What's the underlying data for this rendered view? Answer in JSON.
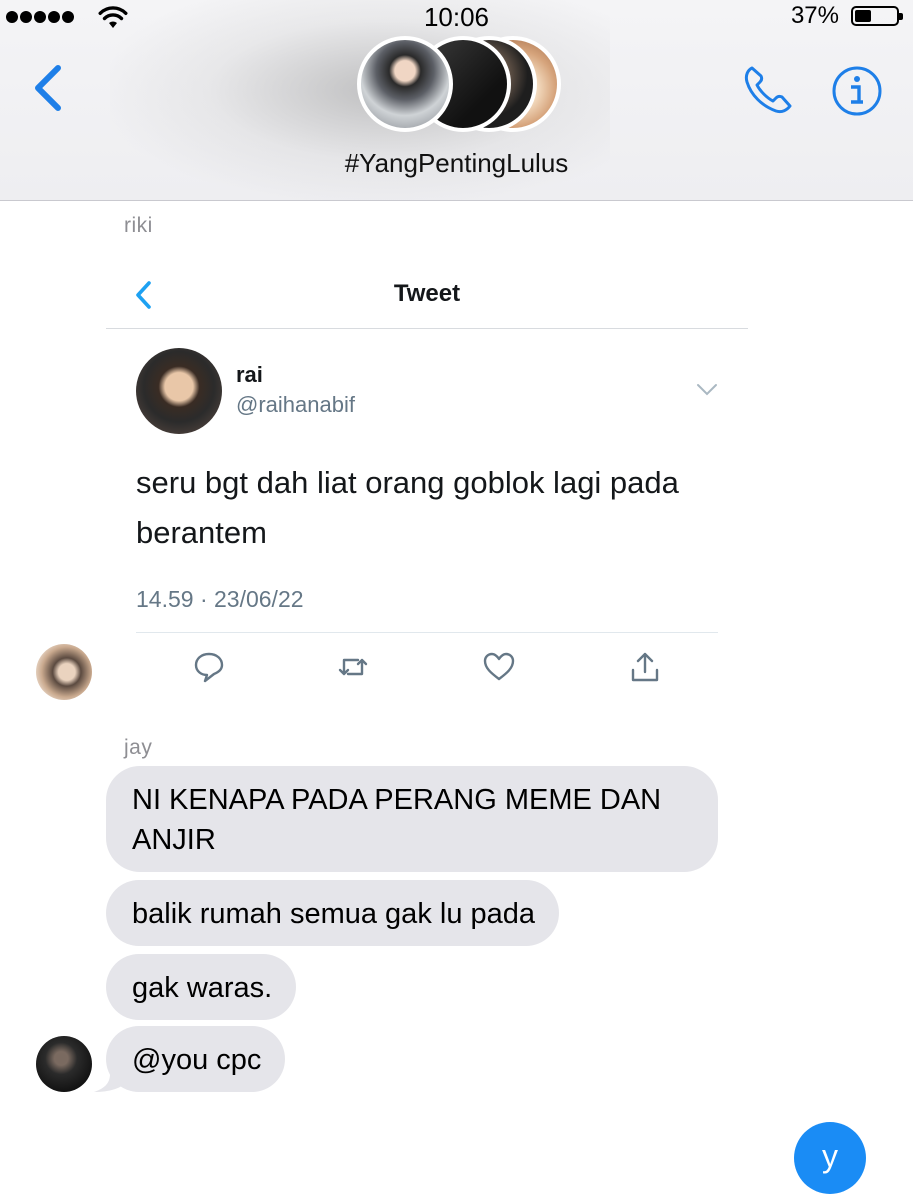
{
  "status": {
    "time": "10:06",
    "battery": "37%"
  },
  "nav": {
    "group_name": "#YangPentingLulus",
    "back_icon": "chevron-left-icon",
    "call_icon": "phone-icon",
    "info_icon": "info-icon"
  },
  "chat": {
    "shared_tweet": {
      "sender": "riki",
      "header_title": "Tweet",
      "author_name": "rai",
      "author_handle": "@raihanabif",
      "text": "seru bgt dah liat orang goblok lagi pada berantem",
      "timestamp": "14.59 · 23/06/22",
      "actions": [
        "reply-icon",
        "retweet-icon",
        "like-icon",
        "share-icon"
      ]
    },
    "messages": [
      {
        "sender": "jay",
        "text": "NI KENAPA PADA PERANG MEME DAN ANJIR"
      },
      {
        "text": "balik rumah semua gak lu pada"
      },
      {
        "text": "gak waras."
      },
      {
        "text": "@you cpc"
      }
    ]
  },
  "compose": {
    "label": "y"
  },
  "colors": {
    "accent": "#1a8cf5",
    "ios_blue": "#1e7fe8",
    "bubble_gray": "#e5e5ea",
    "twitter_gray": "#657786"
  }
}
